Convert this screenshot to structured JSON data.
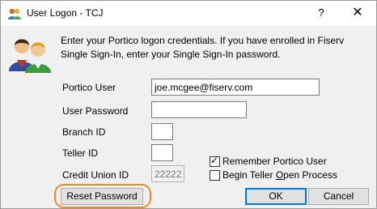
{
  "window": {
    "title": "User Logon - TCJ",
    "help_glyph": "?",
    "close_glyph": "✕"
  },
  "instructions": "Enter your Portico logon credentials. If you have enrolled in Fiserv Single Sign-In, enter your Single Sign-In password.",
  "form": {
    "portico_user_label": "Portico User",
    "portico_user_value": "joe.mcgee@fiserv.com",
    "user_password_label": "User Password",
    "user_password_value": "",
    "branch_id_label": "Branch ID",
    "branch_id_value": "",
    "teller_id_label": "Teller ID",
    "teller_id_value": "",
    "credit_union_id_label": "Credit Union ID",
    "credit_union_id_value": "22222"
  },
  "options": {
    "remember_user_label": "Remember Portico User",
    "remember_user_checked": true,
    "begin_teller_label_pre": "Begin Teller ",
    "begin_teller_label_underlined": "O",
    "begin_teller_label_post": "pen Process",
    "begin_teller_checked": false
  },
  "buttons": {
    "reset_password": "Reset Password",
    "ok": "OK",
    "cancel": "Cancel"
  },
  "colors": {
    "highlight_ring": "#ee8a2d",
    "default_button_border": "#0078d7",
    "dialog_background": "#f0f0f0"
  },
  "icons": {
    "title": "users-icon",
    "dialog": "users-icon"
  }
}
